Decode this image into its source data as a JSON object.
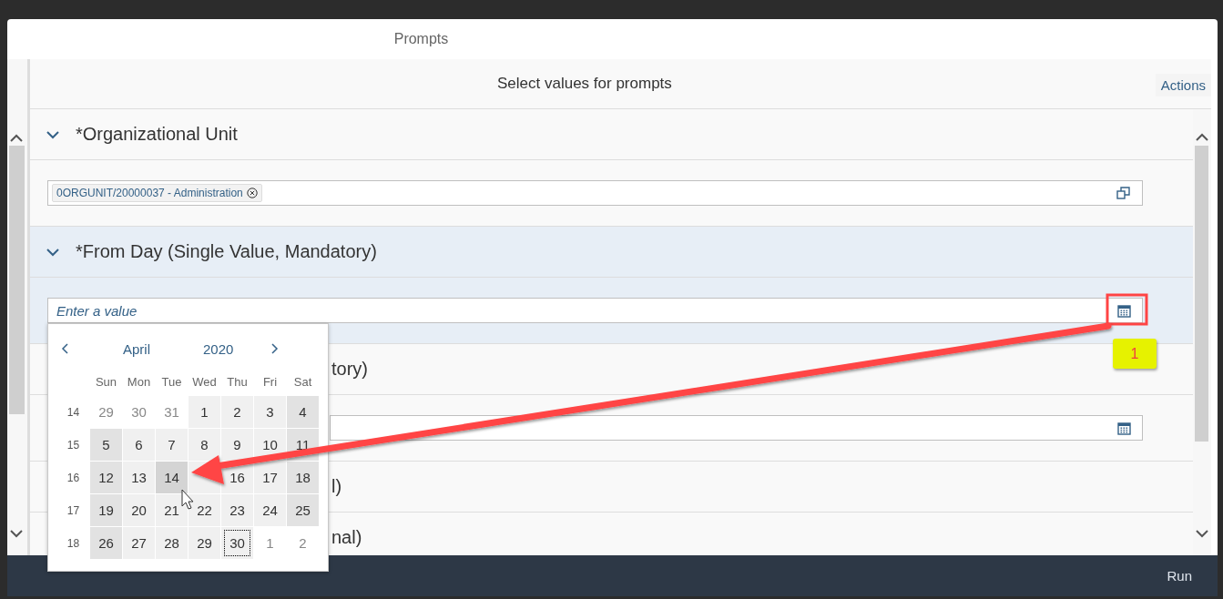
{
  "dialog": {
    "title": "Prompts"
  },
  "panel": {
    "title": "Select values for prompts",
    "actions": "Actions"
  },
  "prompts": [
    {
      "kind": "tokens",
      "label": "*Organizational Unit",
      "selected": false,
      "obscured": false,
      "tokens": [
        "0ORGUNIT/20000037 - Administration"
      ]
    },
    {
      "kind": "date",
      "label": "*From Day (Single Value, Mandatory)",
      "selected": true,
      "obscured": false,
      "placeholder": "Enter a value"
    },
    {
      "kind": "date",
      "label": "tory)",
      "selected": false,
      "obscured": true
    },
    {
      "kind": "none",
      "label": "l)",
      "selected": false,
      "obscured": true
    },
    {
      "kind": "none",
      "label": "nal)",
      "selected": false,
      "obscured": true
    }
  ],
  "calendar": {
    "month": "April",
    "year": "2020",
    "weekdays": [
      "Sun",
      "Mon",
      "Tue",
      "Wed",
      "Thu",
      "Fri",
      "Sat"
    ],
    "weeks": [
      {
        "number": "14",
        "days": [
          {
            "day": "29",
            "kind": "outside",
            "hovered": false,
            "focused": false
          },
          {
            "day": "30",
            "kind": "outside",
            "hovered": false,
            "focused": false
          },
          {
            "day": "31",
            "kind": "outside",
            "hovered": false,
            "focused": false
          },
          {
            "day": "1",
            "kind": "weekday",
            "hovered": false,
            "focused": false
          },
          {
            "day": "2",
            "kind": "weekday",
            "hovered": false,
            "focused": false
          },
          {
            "day": "3",
            "kind": "weekday",
            "hovered": false,
            "focused": false
          },
          {
            "day": "4",
            "kind": "weekend",
            "hovered": false,
            "focused": false
          }
        ]
      },
      {
        "number": "15",
        "days": [
          {
            "day": "5",
            "kind": "weekend",
            "hovered": false,
            "focused": false
          },
          {
            "day": "6",
            "kind": "weekday",
            "hovered": false,
            "focused": false
          },
          {
            "day": "7",
            "kind": "weekday",
            "hovered": false,
            "focused": false
          },
          {
            "day": "8",
            "kind": "weekday",
            "hovered": false,
            "focused": false
          },
          {
            "day": "9",
            "kind": "weekday",
            "hovered": false,
            "focused": false
          },
          {
            "day": "10",
            "kind": "weekday",
            "hovered": false,
            "focused": false
          },
          {
            "day": "11",
            "kind": "weekend",
            "hovered": false,
            "focused": false
          }
        ]
      },
      {
        "number": "16",
        "days": [
          {
            "day": "12",
            "kind": "weekend",
            "hovered": false,
            "focused": false
          },
          {
            "day": "13",
            "kind": "weekday",
            "hovered": false,
            "focused": false
          },
          {
            "day": "14",
            "kind": "weekday",
            "hovered": true,
            "focused": false
          },
          {
            "kind": "weekday",
            "hovered": false,
            "focused": false
          },
          {
            "day": "16",
            "kind": "weekday",
            "hovered": false,
            "focused": false
          },
          {
            "day": "17",
            "kind": "weekday",
            "hovered": false,
            "focused": false
          },
          {
            "day": "18",
            "kind": "weekend",
            "hovered": false,
            "focused": false
          }
        ]
      },
      {
        "number": "17",
        "days": [
          {
            "day": "19",
            "kind": "weekend",
            "hovered": false,
            "focused": false
          },
          {
            "day": "20",
            "kind": "weekday",
            "hovered": false,
            "focused": false
          },
          {
            "day": "21",
            "kind": "weekday",
            "hovered": false,
            "focused": false
          },
          {
            "day": "22",
            "kind": "weekday",
            "hovered": false,
            "focused": false
          },
          {
            "day": "23",
            "kind": "weekday",
            "hovered": false,
            "focused": false
          },
          {
            "day": "24",
            "kind": "weekday",
            "hovered": false,
            "focused": false
          },
          {
            "day": "25",
            "kind": "weekend",
            "hovered": false,
            "focused": false
          }
        ]
      },
      {
        "number": "18",
        "days": [
          {
            "day": "26",
            "kind": "weekend",
            "hovered": false,
            "focused": false
          },
          {
            "day": "27",
            "kind": "weekday",
            "hovered": false,
            "focused": false
          },
          {
            "day": "28",
            "kind": "weekday",
            "hovered": false,
            "focused": false
          },
          {
            "day": "29",
            "kind": "weekday",
            "hovered": false,
            "focused": false
          },
          {
            "day": "30",
            "kind": "weekday",
            "hovered": false,
            "focused": true
          },
          {
            "day": "1",
            "kind": "outside",
            "hovered": false,
            "focused": false
          },
          {
            "day": "2",
            "kind": "outside",
            "hovered": false,
            "focused": false
          }
        ]
      }
    ]
  },
  "annotation": {
    "badge": "1"
  },
  "footer": {
    "run": "Run"
  }
}
